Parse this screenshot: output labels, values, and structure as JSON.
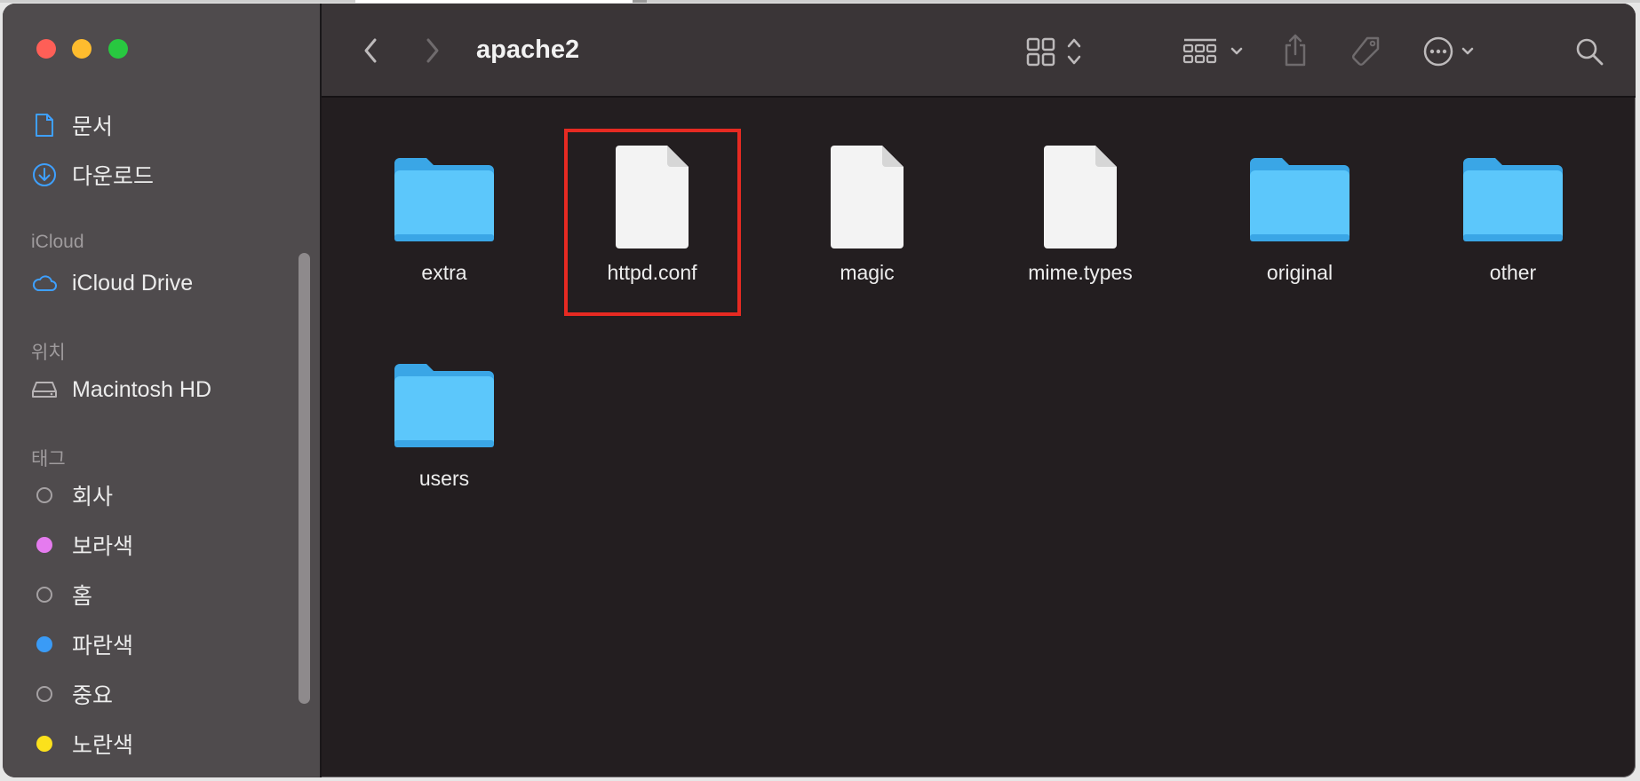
{
  "window": {
    "title": "apache2"
  },
  "sidebar": {
    "favorites": [
      {
        "label": "문서",
        "icon": "document-icon"
      },
      {
        "label": "다운로드",
        "icon": "download-icon"
      }
    ],
    "icloud_header": "iCloud",
    "icloud_items": [
      {
        "label": "iCloud Drive",
        "icon": "cloud-icon"
      }
    ],
    "locations_header": "위치",
    "locations": [
      {
        "label": "Macintosh HD",
        "icon": "hard-drive-icon"
      }
    ],
    "tags_header": "태그",
    "tags": [
      {
        "label": "회사",
        "color": "none"
      },
      {
        "label": "보라색",
        "color": "#e57bef"
      },
      {
        "label": "홈",
        "color": "none"
      },
      {
        "label": "파란색",
        "color": "#3a9bf6"
      },
      {
        "label": "중요",
        "color": "none"
      },
      {
        "label": "노란색",
        "color": "#fbe11c"
      }
    ]
  },
  "toolbar": {
    "back": "chevron-left-icon",
    "forward": "chevron-right-icon",
    "view_mode": "icon-grid-icon",
    "group": "group-by-icon",
    "share": "share-icon",
    "tags": "tag-icon",
    "more": "more-icon",
    "search": "search-icon"
  },
  "files": [
    {
      "name": "extra",
      "kind": "folder"
    },
    {
      "name": "httpd.conf",
      "kind": "document",
      "highlighted": true
    },
    {
      "name": "magic",
      "kind": "document"
    },
    {
      "name": "mime.types",
      "kind": "document"
    },
    {
      "name": "original",
      "kind": "folder"
    },
    {
      "name": "other",
      "kind": "folder"
    },
    {
      "name": "users",
      "kind": "folder"
    }
  ],
  "colors": {
    "folder": "#5ac8fa",
    "highlight": "#e62a22"
  }
}
